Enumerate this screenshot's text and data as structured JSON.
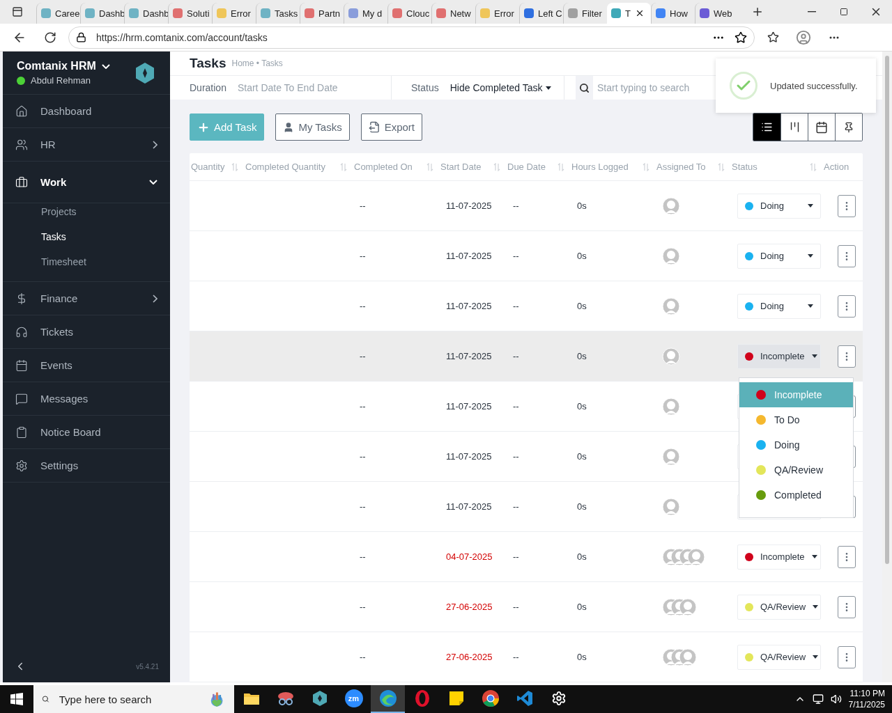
{
  "browser": {
    "tabs": [
      {
        "title": "Caree",
        "color": "#6fb3c4",
        "selected": false
      },
      {
        "title": "Dashb",
        "color": "#6fb3c4",
        "selected": false
      },
      {
        "title": "Dashb",
        "color": "#6fb3c4",
        "selected": false
      },
      {
        "title": "Soluti",
        "color": "#e07070",
        "selected": false
      },
      {
        "title": "Error",
        "color": "#efc65a",
        "selected": false
      },
      {
        "title": "Tasks",
        "color": "#6fb3c4",
        "selected": false
      },
      {
        "title": "Partn",
        "color": "#e07070",
        "selected": false
      },
      {
        "title": "My d",
        "color": "#8a9ddb",
        "selected": false
      },
      {
        "title": "Clouc",
        "color": "#e07070",
        "selected": false
      },
      {
        "title": "Netw",
        "color": "#e07070",
        "selected": false
      },
      {
        "title": "Error",
        "color": "#efc65a",
        "selected": false
      },
      {
        "title": "Left C",
        "color": "#2f6fe0",
        "selected": false
      },
      {
        "title": "Filter",
        "color": "#a0a0a0",
        "selected": false
      },
      {
        "title": "T",
        "color": "#3fa9b8",
        "selected": true
      },
      {
        "title": "How",
        "color": "#4285f4",
        "selected": false
      },
      {
        "title": "Web",
        "color": "#6b5bd6",
        "selected": false
      }
    ],
    "url": "https://hrm.comtanix.com/account/tasks"
  },
  "sidebar": {
    "brand": "Comtanix HRM",
    "user": "Abdul Rehman",
    "online": true,
    "items": [
      {
        "label": "Dashboard",
        "kind": "link"
      },
      {
        "label": "HR",
        "kind": "group",
        "expanded": false
      },
      {
        "label": "Work",
        "kind": "group",
        "expanded": true,
        "children": [
          {
            "label": "Projects",
            "selected": false
          },
          {
            "label": "Tasks",
            "selected": true
          },
          {
            "label": "Timesheet",
            "selected": false
          }
        ]
      },
      {
        "label": "Finance",
        "kind": "group",
        "expanded": false
      },
      {
        "label": "Tickets",
        "kind": "link"
      },
      {
        "label": "Events",
        "kind": "link"
      },
      {
        "label": "Messages",
        "kind": "link"
      },
      {
        "label": "Notice Board",
        "kind": "link"
      },
      {
        "label": "Settings",
        "kind": "link"
      }
    ],
    "version": "v5.4.21"
  },
  "page": {
    "title": "Tasks",
    "breadcrumb": "Home • Tasks"
  },
  "filters": {
    "duration_label": "Duration",
    "duration_value": "Start Date To End Date",
    "status_label": "Status",
    "status_value": "Hide Completed Task",
    "search_placeholder": "Start typing to search"
  },
  "toolbar": {
    "buttons": [
      {
        "label": "Add Task",
        "kind": "primary"
      },
      {
        "label": "My Tasks",
        "kind": "outline"
      },
      {
        "label": "Export",
        "kind": "outline"
      }
    ],
    "views": [
      {
        "selected": true
      },
      {
        "selected": false
      },
      {
        "selected": false
      },
      {
        "selected": false
      }
    ]
  },
  "toast": {
    "message": "Updated successfully."
  },
  "table": {
    "columns": [
      {
        "label": "Quantity",
        "sortable": true
      },
      {
        "label": "Completed Quantity",
        "sortable": true
      },
      {
        "label": "Completed On",
        "sortable": true
      },
      {
        "label": "Start Date",
        "sortable": true
      },
      {
        "label": "Due Date",
        "sortable": true
      },
      {
        "label": "Hours Logged",
        "sortable": true
      },
      {
        "label": "Assigned To",
        "sortable": true
      },
      {
        "label": "Status",
        "sortable": true
      },
      {
        "label": "Action",
        "sortable": false
      }
    ],
    "rows": [
      {
        "completed_on": "--",
        "start_date": "11-07-2025",
        "overdue": false,
        "due_date": "--",
        "hours": "0s",
        "assignees": [
          {
            "kind": "avatar"
          }
        ],
        "highlighted": false,
        "status": {
          "label": "Doing",
          "color": "#1ab2f0"
        }
      },
      {
        "completed_on": "--",
        "start_date": "11-07-2025",
        "overdue": false,
        "due_date": "--",
        "hours": "0s",
        "assignees": [
          {
            "kind": "avatar"
          }
        ],
        "highlighted": false,
        "status": {
          "label": "Doing",
          "color": "#1ab2f0"
        }
      },
      {
        "completed_on": "--",
        "start_date": "11-07-2025",
        "overdue": false,
        "due_date": "--",
        "hours": "0s",
        "assignees": [
          {
            "kind": "avatar"
          }
        ],
        "highlighted": false,
        "status": {
          "label": "Doing",
          "color": "#1ab2f0"
        }
      },
      {
        "completed_on": "--",
        "start_date": "11-07-2025",
        "overdue": false,
        "due_date": "--",
        "hours": "0s",
        "assignees": [
          {
            "kind": "avatar"
          }
        ],
        "highlighted": true,
        "status": {
          "label": "Incomplete",
          "color": "#d0021b",
          "menu": {
            "open": true,
            "options": [
              {
                "label": "Incomplete",
                "color": "#d0021b",
                "selected": true
              },
              {
                "label": "To Do",
                "color": "#f5b82e",
                "selected": false
              },
              {
                "label": "Doing",
                "color": "#1ab2f0",
                "selected": false
              },
              {
                "label": "QA/Review",
                "color": "#e3e65a",
                "selected": false
              },
              {
                "label": "Completed",
                "color": "#679c0d",
                "selected": false
              }
            ]
          }
        }
      },
      {
        "completed_on": "--",
        "start_date": "11-07-2025",
        "overdue": false,
        "due_date": "--",
        "hours": "0s",
        "assignees": [
          {
            "kind": "avatar"
          }
        ],
        "highlighted": false
      },
      {
        "completed_on": "--",
        "start_date": "11-07-2025",
        "overdue": false,
        "due_date": "--",
        "hours": "0s",
        "assignees": [
          {
            "kind": "avatar"
          }
        ],
        "highlighted": false
      },
      {
        "completed_on": "--",
        "start_date": "11-07-2025",
        "overdue": false,
        "due_date": "--",
        "hours": "0s",
        "assignees": [
          {
            "kind": "avatar"
          }
        ],
        "highlighted": false
      },
      {
        "completed_on": "--",
        "start_date": "04-07-2025",
        "overdue": true,
        "due_date": "--",
        "hours": "0s",
        "assignees": [
          {
            "kind": "avatar"
          },
          {
            "kind": "avatar"
          },
          {
            "kind": "avatar"
          },
          {
            "kind": "avatar"
          }
        ],
        "highlighted": false,
        "status": {
          "label": "Incomplete",
          "color": "#d0021b"
        }
      },
      {
        "completed_on": "--",
        "start_date": "27-06-2025",
        "overdue": true,
        "due_date": "--",
        "hours": "0s",
        "assignees": [
          {
            "kind": "avatar"
          },
          {
            "kind": "avatar"
          },
          {
            "kind": "avatar"
          }
        ],
        "highlighted": false,
        "status": {
          "label": "QA/Review",
          "color": "#e3e65a"
        }
      },
      {
        "completed_on": "--",
        "start_date": "27-06-2025",
        "overdue": true,
        "due_date": "--",
        "hours": "0s",
        "assignees": [
          {
            "kind": "avatar"
          },
          {
            "kind": "avatar"
          },
          {
            "kind": "avatar"
          }
        ],
        "highlighted": false,
        "status": {
          "label": "QA/Review",
          "color": "#e3e65a"
        }
      }
    ]
  },
  "taskbar": {
    "search_placeholder": "Type here to search",
    "apps": [
      {
        "kind": "folder",
        "active": false
      },
      {
        "kind": "snip",
        "active": false
      },
      {
        "kind": "hex",
        "active": false
      },
      {
        "kind": "zoom",
        "label": "zm",
        "active": false
      },
      {
        "kind": "edge",
        "active": true
      },
      {
        "kind": "opera",
        "active": false
      },
      {
        "kind": "notes",
        "active": false
      },
      {
        "kind": "chrome",
        "active": false
      },
      {
        "kind": "code",
        "active": false
      },
      {
        "kind": "settings",
        "active": false
      }
    ],
    "time": "11:10 PM",
    "date": "7/11/2025"
  }
}
